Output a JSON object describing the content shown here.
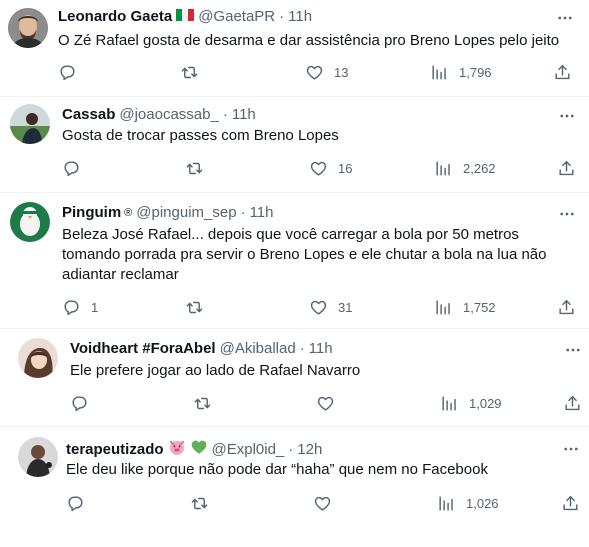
{
  "tweets": [
    {
      "name": "Leonardo Gaeta",
      "flag": "🇮🇹",
      "handle": "@GaetaPR",
      "time": "11h",
      "text": "O Zé Rafael gosta de desarma e dar assistência pro Breno Lopes pelo jeito",
      "replies": "",
      "reposts": "",
      "likes": "13",
      "views": "1,796"
    },
    {
      "name": "Cassab",
      "handle": "@joaocassab_",
      "time": "11h",
      "text": "Gosta de trocar passes com Breno Lopes",
      "replies": "",
      "reposts": "",
      "likes": "16",
      "views": "2,262"
    },
    {
      "name": "Pinguim",
      "badge": "®",
      "handle": "@pinguim_sep",
      "time": "11h",
      "text": "Beleza José Rafael... depois que você carregar a bola por 50 metros\ntomando porrada pra servir o Breno Lopes e ele chutar a bola na lua não\nadiantar reclamar",
      "replies": "1",
      "reposts": "",
      "likes": "31",
      "views": "1,752"
    },
    {
      "name": "Voidheart #ForaAbel",
      "handle": "@Akiballad",
      "time": "11h",
      "text": "Ele prefere jogar ao lado de Rafael Navarro",
      "replies": "",
      "reposts": "",
      "likes": "",
      "views": "1,029"
    },
    {
      "name": "terapeutizado",
      "emojis": [
        "🐷",
        "💚"
      ],
      "handle": "@Expl0id_",
      "time": "12h",
      "text": "Ele deu like porque não pode dar “haha” que nem no Facebook",
      "replies": "",
      "reposts": "",
      "likes": "",
      "views": "1,026"
    }
  ],
  "separator": "·",
  "colors": {
    "text": "#0f1419",
    "secondary": "#536471",
    "divider": "#eff3f4",
    "heart": "#f91880",
    "flag_green": "#009246",
    "flag_red": "#ce2b37"
  },
  "icons": [
    "reply-icon",
    "repost-icon",
    "like-icon",
    "views-icon",
    "share-icon",
    "more-icon"
  ]
}
